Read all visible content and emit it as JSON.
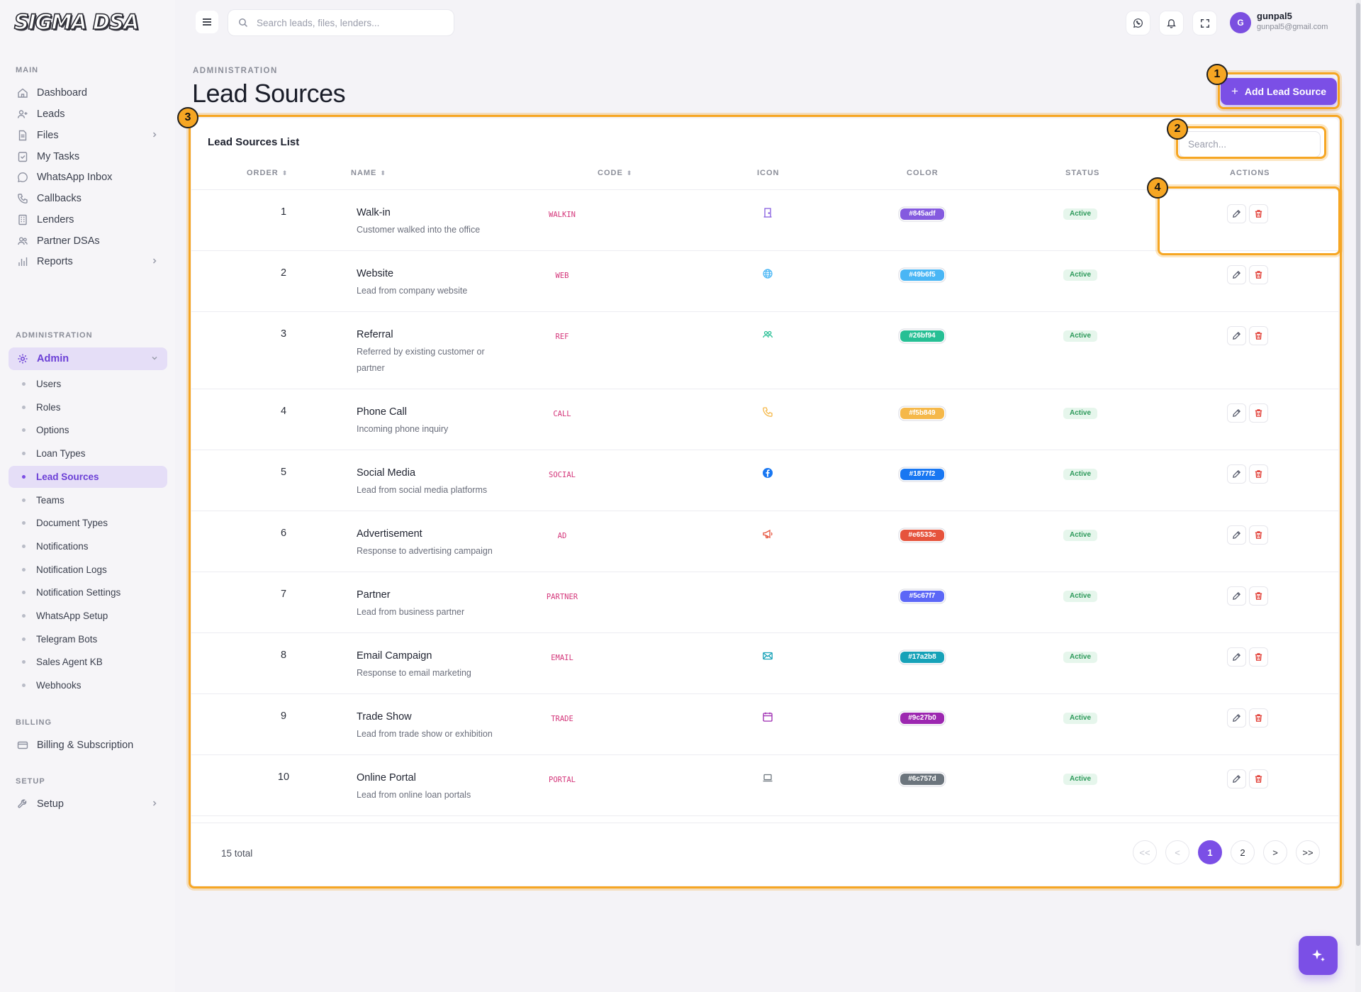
{
  "app": {
    "logo_text": "SIGMA DSA"
  },
  "sidebar": {
    "sections": {
      "main": "MAIN",
      "administration": "ADMINISTRATION",
      "billing": "BILLING",
      "setup": "SETUP"
    },
    "main_items": [
      {
        "label": "Dashboard",
        "icon": "home-icon"
      },
      {
        "label": "Leads",
        "icon": "user-plus-icon"
      },
      {
        "label": "Files",
        "icon": "file-icon",
        "has_children": true
      },
      {
        "label": "My Tasks",
        "icon": "checklist-icon"
      },
      {
        "label": "WhatsApp Inbox",
        "icon": "whatsapp-icon"
      },
      {
        "label": "Callbacks",
        "icon": "phone-icon"
      },
      {
        "label": "Lenders",
        "icon": "building-icon"
      },
      {
        "label": "Partner DSAs",
        "icon": "users-icon"
      },
      {
        "label": "Reports",
        "icon": "bar-chart-icon",
        "has_children": true
      }
    ],
    "admin": {
      "label": "Admin",
      "icon": "gear-icon",
      "expanded": true
    },
    "admin_items": [
      "Users",
      "Roles",
      "Options",
      "Loan Types",
      "Lead Sources",
      "Teams",
      "Document Types",
      "Notifications",
      "Notification Logs",
      "Notification Settings",
      "WhatsApp Setup",
      "Telegram Bots",
      "Sales Agent KB",
      "Webhooks"
    ],
    "active_admin_item": "Lead Sources",
    "billing_item": "Billing & Subscription",
    "setup_item": "Setup"
  },
  "topbar": {
    "search_placeholder": "Search leads, files, lenders...",
    "user": {
      "initial": "G",
      "name": "gunpal5",
      "email": "gunpal5@gmail.com"
    }
  },
  "page": {
    "breadcrumb": "ADMINISTRATION",
    "title": "Lead Sources",
    "add_button": "Add Lead Source"
  },
  "card": {
    "title": "Lead Sources List",
    "search_placeholder": "Search...",
    "columns": [
      "ORDER",
      "NAME",
      "CODE",
      "ICON",
      "COLOR",
      "STATUS",
      "ACTIONS"
    ],
    "rows": [
      {
        "order": "1",
        "name": "Walk-in",
        "desc": "Customer walked into the office",
        "code": "WALKIN",
        "icon": "door-icon",
        "color": "#845adf",
        "status": "Active"
      },
      {
        "order": "2",
        "name": "Website",
        "desc": "Lead from company website",
        "code": "WEB",
        "icon": "globe-icon",
        "color": "#49b6f5",
        "status": "Active"
      },
      {
        "order": "3",
        "name": "Referral",
        "desc": "Referred by existing customer or partner",
        "code": "REF",
        "icon": "users-icon",
        "color": "#26bf94",
        "status": "Active"
      },
      {
        "order": "4",
        "name": "Phone Call",
        "desc": "Incoming phone inquiry",
        "code": "CALL",
        "icon": "phone-icon",
        "color": "#f5b849",
        "status": "Active"
      },
      {
        "order": "5",
        "name": "Social Media",
        "desc": "Lead from social media platforms",
        "code": "SOCIAL",
        "icon": "facebook-icon",
        "color": "#1877f2",
        "status": "Active"
      },
      {
        "order": "6",
        "name": "Advertisement",
        "desc": "Response to advertising campaign",
        "code": "AD",
        "icon": "megaphone-icon",
        "color": "#e6533c",
        "status": "Active"
      },
      {
        "order": "7",
        "name": "Partner",
        "desc": "Lead from business partner",
        "code": "PARTNER",
        "icon": "",
        "color": "#5c67f7",
        "status": "Active"
      },
      {
        "order": "8",
        "name": "Email Campaign",
        "desc": "Response to email marketing",
        "code": "EMAIL",
        "icon": "mail-icon",
        "color": "#17a2b8",
        "status": "Active"
      },
      {
        "order": "9",
        "name": "Trade Show",
        "desc": "Lead from trade show or exhibition",
        "code": "TRADE",
        "icon": "calendar-icon",
        "color": "#9c27b0",
        "status": "Active"
      },
      {
        "order": "10",
        "name": "Online Portal",
        "desc": "Lead from online loan portals",
        "code": "PORTAL",
        "icon": "laptop-icon",
        "color": "#6c757d",
        "status": "Active"
      }
    ],
    "total": "15 total",
    "pagination": {
      "first": "<<",
      "prev": "<",
      "pages": [
        "1",
        "2"
      ],
      "current": "1",
      "next": ">",
      "last": ">>"
    }
  },
  "annotations": [
    "1",
    "2",
    "3",
    "4"
  ],
  "colors": {
    "accent": "#7b4fe6",
    "highlight": "#f6a623",
    "code_text": "#d4367a",
    "status_green": "#2e9a5b"
  }
}
